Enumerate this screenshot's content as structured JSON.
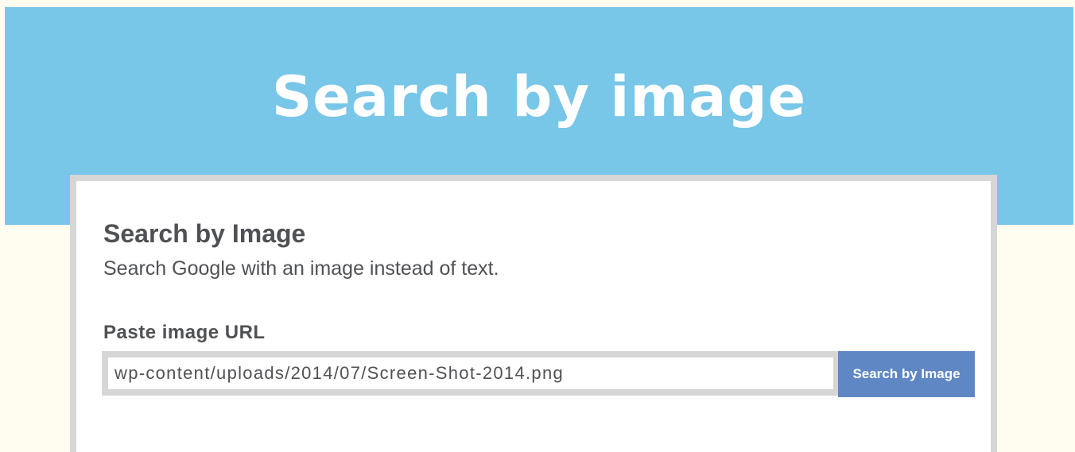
{
  "hero": {
    "title": "Search by image"
  },
  "card": {
    "heading": "Search by Image",
    "subtitle": "Search Google with an image instead of text.",
    "url_label": "Paste image URL",
    "url_value": "wp-content/uploads/2014/07/Screen-Shot-2014.png",
    "button_label": "Search by Image"
  },
  "colors": {
    "hero_background": "#78c6e8",
    "page_background": "#fffdf0",
    "card_border": "#d6d6d6",
    "button_background": "#5f87c4",
    "text": "#4f5154"
  }
}
